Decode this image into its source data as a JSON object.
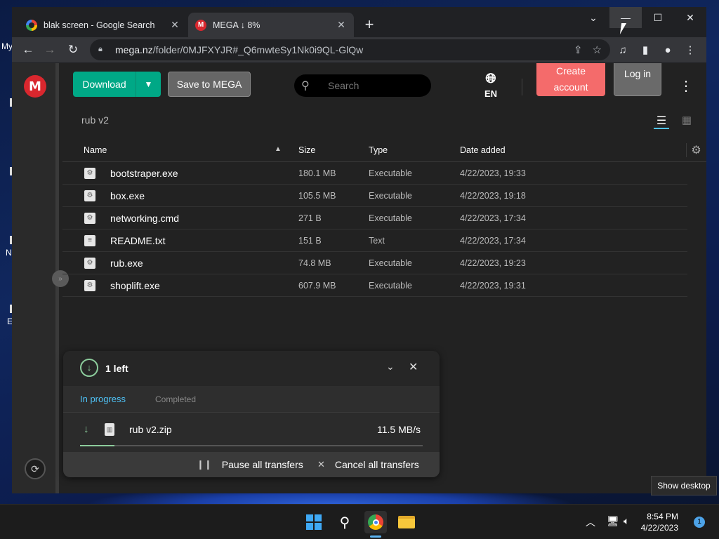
{
  "desktop": {
    "labels": [
      "My",
      "N",
      "E"
    ]
  },
  "browser": {
    "tabs": [
      {
        "title": "blak screen - Google Search",
        "favicon": "google-icon"
      },
      {
        "title": "MEGA ↓ 8%",
        "favicon": "mega-icon",
        "active": true
      }
    ],
    "url_domain": "mega.nz",
    "url_path": "/folder/0MJFXYJR#_Q6mwteSy1Nk0i9QL-GlQw"
  },
  "mega": {
    "logo_letter": "M",
    "download_label": "Download",
    "save_label": "Save to MEGA",
    "search_placeholder": "Search",
    "language": "EN",
    "create_account_label": "Create account",
    "login_label": "Log in",
    "breadcrumb": "rub v2",
    "columns": {
      "name": "Name",
      "size": "Size",
      "type": "Type",
      "date": "Date added"
    },
    "files": [
      {
        "name": "bootstraper.exe",
        "size": "180.1 MB",
        "type": "Executable",
        "date": "4/22/2023, 19:33",
        "icon": "executable-file-icon"
      },
      {
        "name": "box.exe",
        "size": "105.5 MB",
        "type": "Executable",
        "date": "4/22/2023, 19:18",
        "icon": "executable-file-icon"
      },
      {
        "name": "networking.cmd",
        "size": "271 B",
        "type": "Executable",
        "date": "4/22/2023, 17:34",
        "icon": "executable-file-icon"
      },
      {
        "name": "README.txt",
        "size": "151 B",
        "type": "Text",
        "date": "4/22/2023, 17:34",
        "icon": "text-file-icon"
      },
      {
        "name": "rub.exe",
        "size": "74.8 MB",
        "type": "Executable",
        "date": "4/22/2023, 19:23",
        "icon": "executable-file-icon"
      },
      {
        "name": "shoplift.exe",
        "size": "607.9 MB",
        "type": "Executable",
        "date": "4/22/2023, 19:31",
        "icon": "executable-file-icon"
      }
    ],
    "transfers": {
      "title": "1 left",
      "tab_in_progress": "In progress",
      "tab_completed": "Completed",
      "item_name": "rub v2.zip",
      "item_speed": "11.5 MB/s",
      "progress_fraction": 0.1,
      "pause_label": "Pause all transfers",
      "cancel_label": "Cancel all transfers"
    },
    "colors": {
      "accent": "#00a886",
      "create": "#f46b6b",
      "link": "#4fc3f7"
    }
  },
  "tooltip": "Show desktop",
  "taskbar": {
    "time": "8:54 PM",
    "date": "4/22/2023",
    "notifications": "1"
  }
}
